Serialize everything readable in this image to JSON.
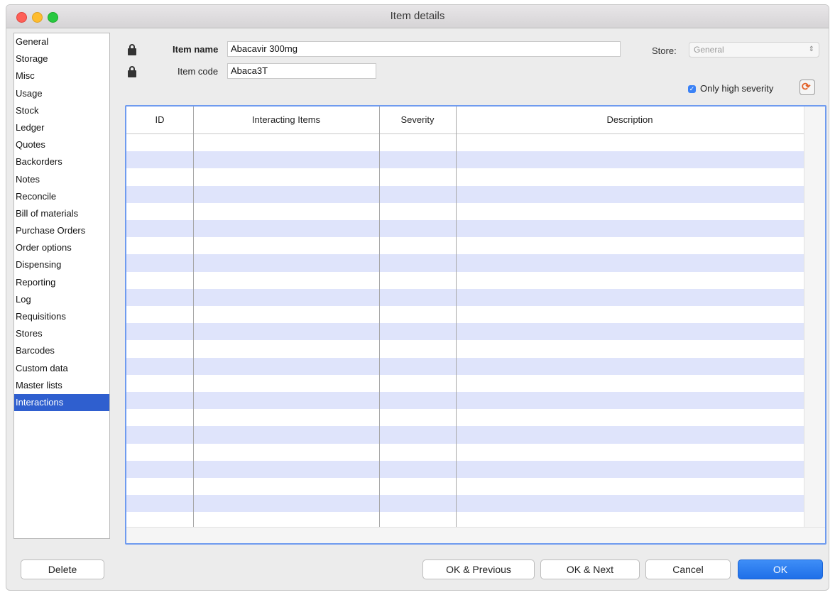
{
  "window": {
    "title": "Item details"
  },
  "sidebar": {
    "items": [
      {
        "label": "General"
      },
      {
        "label": "Storage"
      },
      {
        "label": "Misc"
      },
      {
        "label": "Usage"
      },
      {
        "label": "Stock"
      },
      {
        "label": "Ledger"
      },
      {
        "label": "Quotes"
      },
      {
        "label": "Backorders"
      },
      {
        "label": "Notes"
      },
      {
        "label": "Reconcile"
      },
      {
        "label": "Bill of materials"
      },
      {
        "label": "Purchase Orders"
      },
      {
        "label": "Order options"
      },
      {
        "label": "Dispensing"
      },
      {
        "label": "Reporting"
      },
      {
        "label": "Log"
      },
      {
        "label": "Requisitions"
      },
      {
        "label": "Stores"
      },
      {
        "label": "Barcodes"
      },
      {
        "label": "Custom data"
      },
      {
        "label": "Master lists"
      },
      {
        "label": "Interactions",
        "selected": true
      }
    ]
  },
  "header": {
    "item_name_label": "Item name",
    "item_name_value": "Abacavir 300mg",
    "item_code_label": "Item code",
    "item_code_value": "Abaca3T",
    "store_label": "Store:",
    "store_value": "General",
    "only_high_severity_label": "Only high severity",
    "only_high_severity_checked": true
  },
  "table": {
    "columns": [
      "ID",
      "Interacting Items",
      "Severity",
      "Description"
    ],
    "rows": []
  },
  "buttons": {
    "delete": "Delete",
    "ok_previous": "OK & Previous",
    "ok_next": "OK & Next",
    "cancel": "Cancel",
    "ok": "OK"
  },
  "icons": {
    "item_name_lock": "lock-icon",
    "item_code_lock": "lock-icon",
    "refresh": "refresh-icon"
  },
  "colors": {
    "selection": "#2f5fcf",
    "row_stripe": "#dfe4fb",
    "table_focus": "#6f9bef",
    "primary_button": "#1f6fe8"
  }
}
